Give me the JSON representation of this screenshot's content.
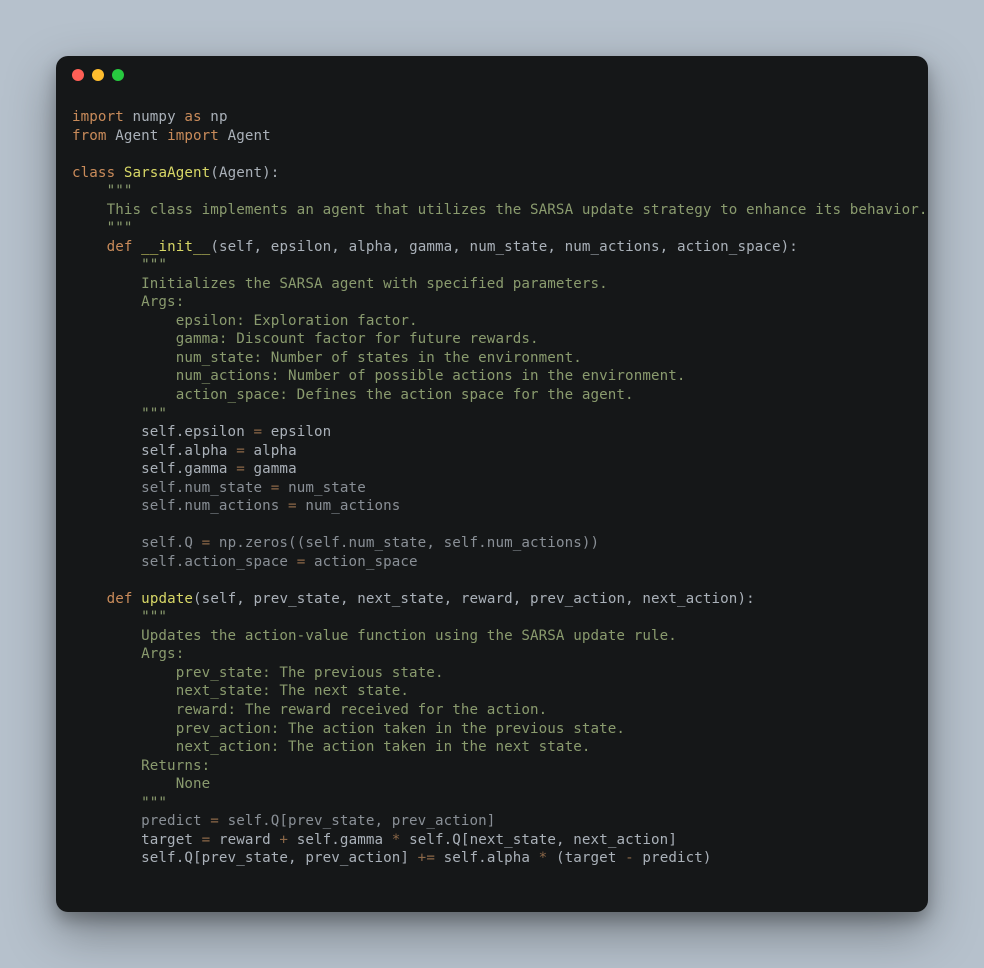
{
  "code": [
    [
      [
        "kw",
        "import"
      ],
      [
        "pl",
        " numpy "
      ],
      [
        "kw",
        "as"
      ],
      [
        "pl",
        " np"
      ]
    ],
    [
      [
        "kw",
        "from"
      ],
      [
        "pl",
        " Agent "
      ],
      [
        "kw",
        "import"
      ],
      [
        "pl",
        " Agent"
      ]
    ],
    [],
    [
      [
        "kw",
        "class"
      ],
      [
        "pl",
        " "
      ],
      [
        "nm",
        "SarsaAgent"
      ],
      [
        "pl",
        "(Agent):"
      ]
    ],
    [
      [
        "pl",
        "    "
      ],
      [
        "st",
        "\"\"\""
      ]
    ],
    [
      [
        "st",
        "    This class implements an agent that utilizes the SARSA update strategy to enhance its behavior."
      ]
    ],
    [
      [
        "st",
        "    \"\"\""
      ]
    ],
    [
      [
        "pl",
        "    "
      ],
      [
        "kw",
        "def"
      ],
      [
        "pl",
        " "
      ],
      [
        "nm",
        "__init__"
      ],
      [
        "pl",
        "(self, epsilon, alpha, gamma, num_state, num_actions, action_space):"
      ]
    ],
    [
      [
        "pl",
        "        "
      ],
      [
        "st",
        "\"\"\""
      ]
    ],
    [
      [
        "st",
        "        Initializes the SARSA agent with specified parameters."
      ]
    ],
    [
      [
        "st",
        "        Args:"
      ]
    ],
    [
      [
        "st",
        "            epsilon: Exploration factor."
      ]
    ],
    [
      [
        "st",
        "            gamma: Discount factor for future rewards."
      ]
    ],
    [
      [
        "st",
        "            num_state: Number of states in the environment."
      ]
    ],
    [
      [
        "st",
        "            num_actions: Number of possible actions in the environment."
      ]
    ],
    [
      [
        "st",
        "            action_space: Defines the action space for the agent."
      ]
    ],
    [
      [
        "st",
        "        \"\"\""
      ]
    ],
    [
      [
        "pl",
        "        self.epsilon "
      ],
      [
        "dm",
        "="
      ],
      [
        "pl",
        " epsilon"
      ]
    ],
    [
      [
        "pl",
        "        self.alpha "
      ],
      [
        "dm",
        "="
      ],
      [
        "pl",
        " alpha"
      ]
    ],
    [
      [
        "pl",
        "        self.gamma "
      ],
      [
        "dm",
        "="
      ],
      [
        "pl",
        " gamma"
      ]
    ],
    [
      [
        "hi",
        "        self.num_state "
      ],
      [
        "dm",
        "="
      ],
      [
        "hi",
        " num_state"
      ]
    ],
    [
      [
        "hi",
        "        self.num_actions "
      ],
      [
        "dm",
        "="
      ],
      [
        "hi",
        " num_actions"
      ]
    ],
    [],
    [
      [
        "hi",
        "        self.Q "
      ],
      [
        "dm",
        "="
      ],
      [
        "hi",
        " np.zeros((self.num_state, self.num_actions))"
      ]
    ],
    [
      [
        "hi",
        "        self.action_space "
      ],
      [
        "dm",
        "="
      ],
      [
        "hi",
        " action_space"
      ]
    ],
    [],
    [
      [
        "pl",
        "    "
      ],
      [
        "kw",
        "def"
      ],
      [
        "pl",
        " "
      ],
      [
        "nm",
        "update"
      ],
      [
        "pl",
        "(self, prev_state, next_state, reward, prev_action, next_action):"
      ]
    ],
    [
      [
        "pl",
        "        "
      ],
      [
        "st",
        "\"\"\""
      ]
    ],
    [
      [
        "st",
        "        Updates the action-value function using the SARSA update rule."
      ]
    ],
    [
      [
        "st",
        "        Args:"
      ]
    ],
    [
      [
        "st",
        "            prev_state: The previous state."
      ]
    ],
    [
      [
        "st",
        "            next_state: The next state."
      ]
    ],
    [
      [
        "st",
        "            reward: The reward received for the action."
      ]
    ],
    [
      [
        "st",
        "            prev_action: The action taken in the previous state."
      ]
    ],
    [
      [
        "st",
        "            next_action: The action taken in the next state."
      ]
    ],
    [
      [
        "st",
        "        Returns:"
      ]
    ],
    [
      [
        "st",
        "            None"
      ]
    ],
    [
      [
        "st",
        "        \"\"\""
      ]
    ],
    [
      [
        "hi",
        "        predict "
      ],
      [
        "dm",
        "="
      ],
      [
        "hi",
        " self.Q[prev_state, prev_action]"
      ]
    ],
    [
      [
        "pl",
        "        target "
      ],
      [
        "dm",
        "="
      ],
      [
        "pl",
        " reward "
      ],
      [
        "dm",
        "+"
      ],
      [
        "pl",
        " self.gamma "
      ],
      [
        "dm",
        "*"
      ],
      [
        "pl",
        " self.Q[next_state, next_action]"
      ]
    ],
    [
      [
        "pl",
        "        self.Q[prev_state, prev_action] "
      ],
      [
        "dm",
        "+="
      ],
      [
        "pl",
        " self.alpha "
      ],
      [
        "dm",
        "*"
      ],
      [
        "pl",
        " (target "
      ],
      [
        "dm",
        "-"
      ],
      [
        "pl",
        " predict)"
      ]
    ]
  ]
}
